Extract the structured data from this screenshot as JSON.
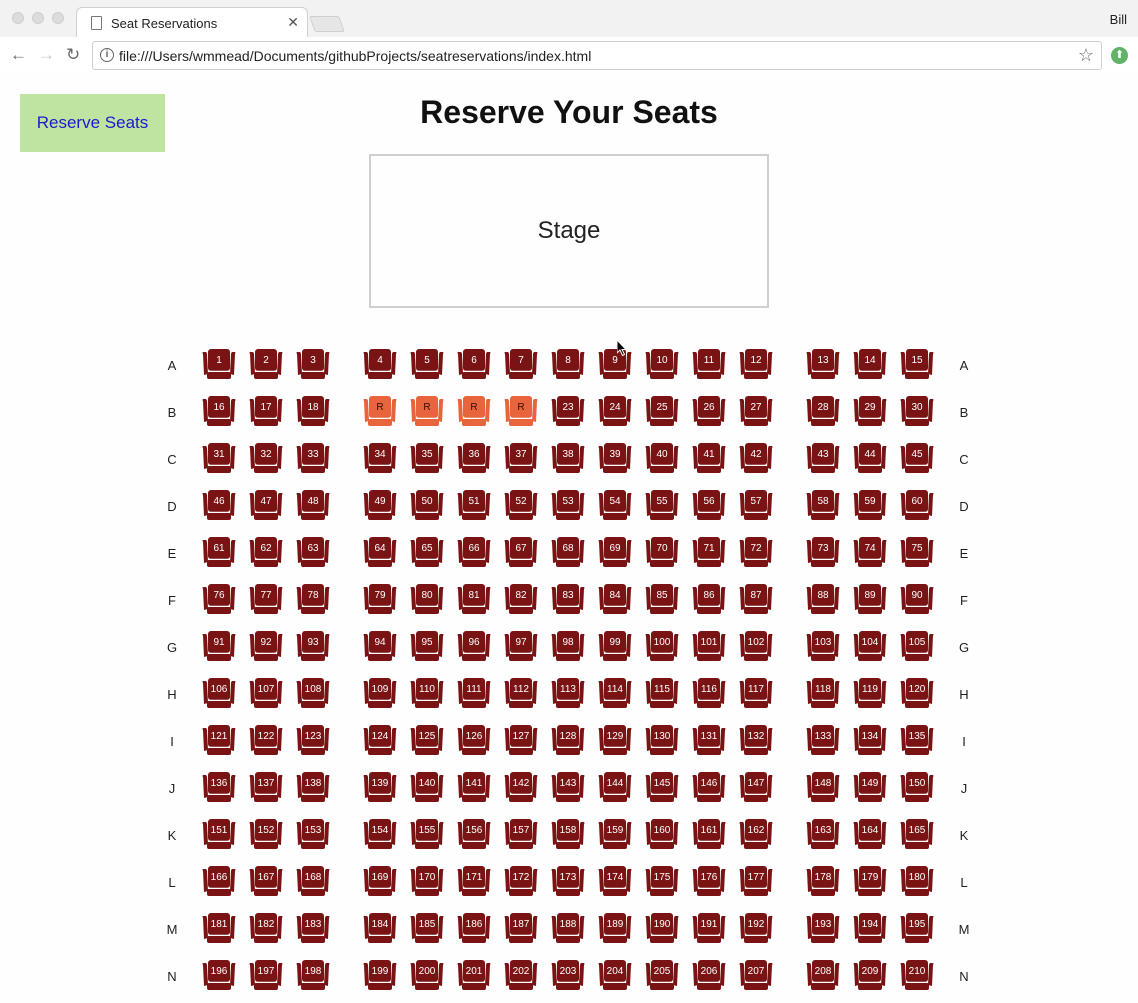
{
  "browser": {
    "tab_title": "Seat Reservations",
    "url": "file:///Users/wmmead/Documents/githubProjects/seatreservations/index.html",
    "user": "Bill"
  },
  "page": {
    "reserve_button": "Reserve Seats",
    "title": "Reserve Your Seats",
    "stage_label": "Stage"
  },
  "colors": {
    "seat_available": "#7a1414",
    "seat_reserved": "#e8643c",
    "button_bg": "#bfe3a0",
    "button_text": "#1a1ad0"
  },
  "seating": {
    "rows": [
      "A",
      "B",
      "C",
      "D",
      "E",
      "F",
      "G",
      "H",
      "I",
      "J",
      "K",
      "L",
      "M",
      "N"
    ],
    "seats_per_row": 15,
    "reserved_seats": [
      19,
      20,
      21,
      22
    ],
    "reserved_label": "R"
  }
}
